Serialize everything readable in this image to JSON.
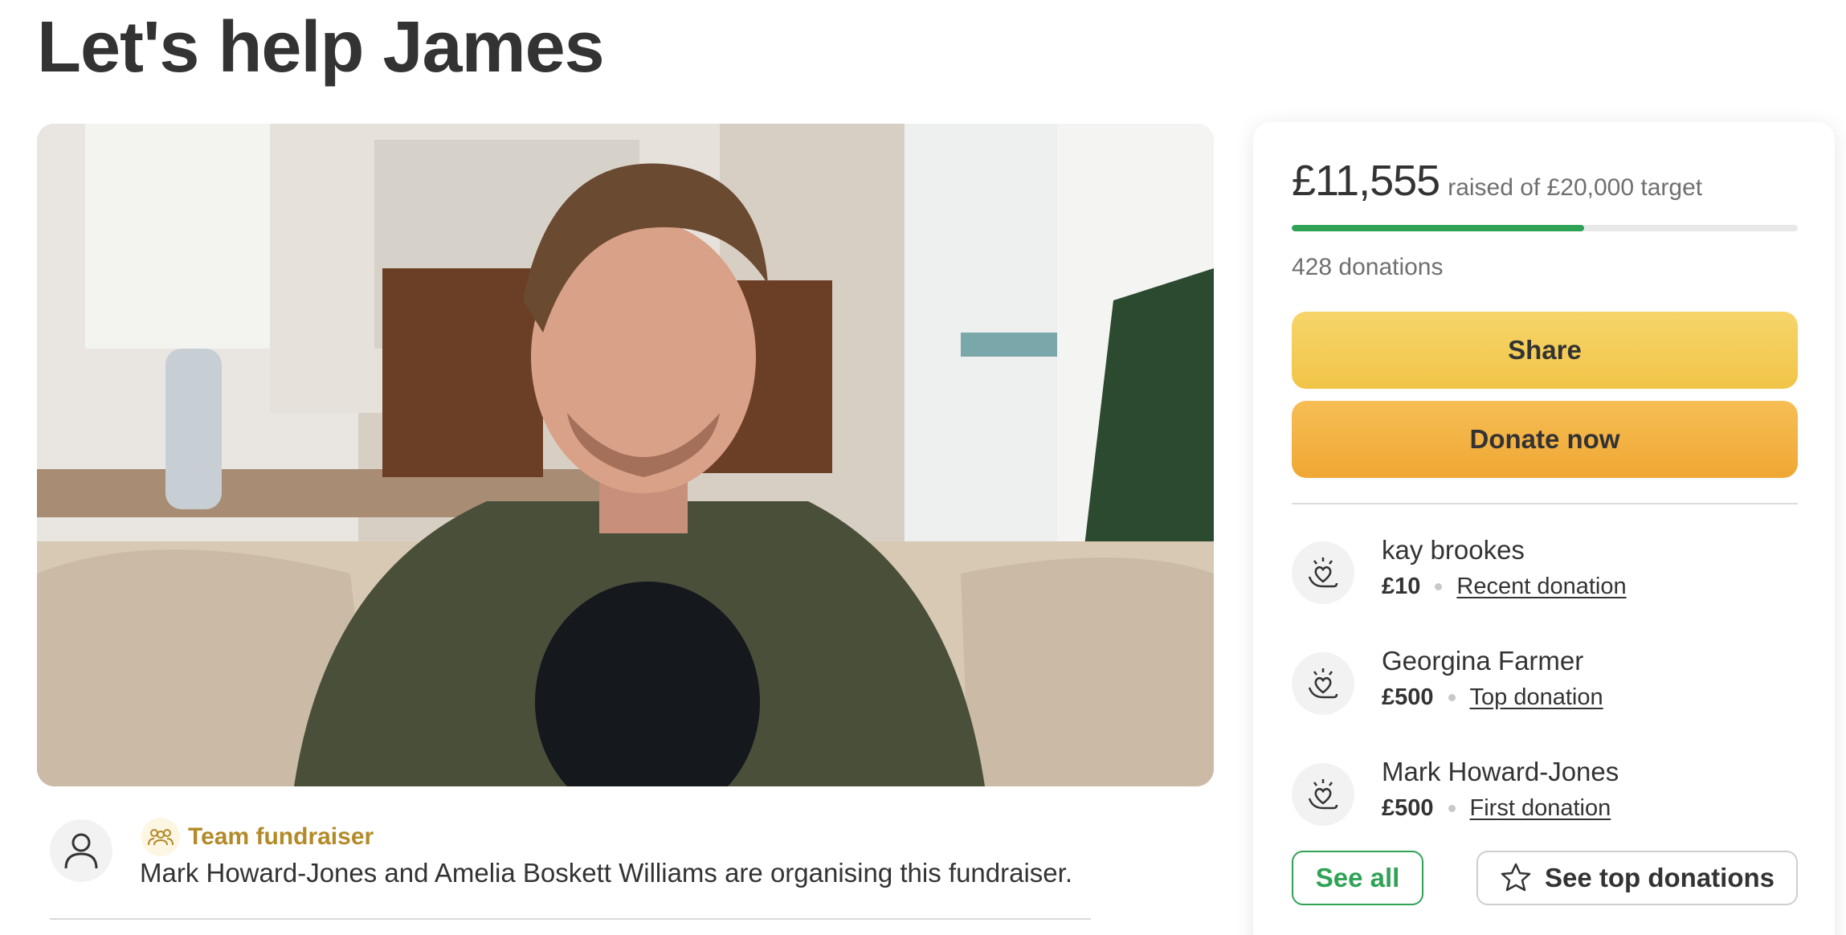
{
  "page": {
    "title": "Let's help James"
  },
  "hero": {
    "icon": "photo"
  },
  "organiser": {
    "team_label": "Team fundraiser",
    "text": "Mark Howard-Jones and Amelia Boskett Williams are organising this fundraiser."
  },
  "card": {
    "amount": "£11,555",
    "target_text": "raised of £20,000 target",
    "progress_fraction": 0.5778,
    "donations_count": "428 donations",
    "share_label": "Share",
    "donate_label": "Donate now",
    "donations": [
      {
        "name": "kay brookes",
        "amount": "£10",
        "tag": "Recent donation"
      },
      {
        "name": "Georgina Farmer",
        "amount": "£500",
        "tag": "Top donation"
      },
      {
        "name": "Mark Howard-Jones",
        "amount": "£500",
        "tag": "First donation"
      }
    ],
    "see_all_label": "See all",
    "see_top_label": "See top donations"
  },
  "colors": {
    "accent_green": "#2fa255",
    "share_yellow": "#f1c447",
    "donate_orange": "#f0a733",
    "team_gold": "#b38a28"
  }
}
